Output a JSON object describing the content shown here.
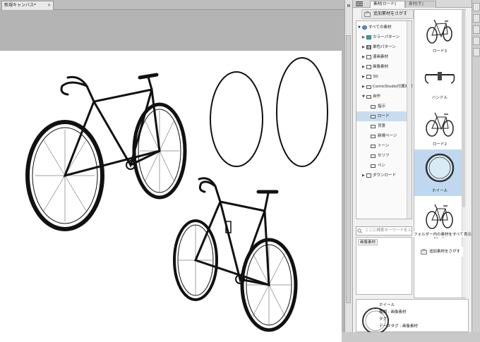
{
  "document": {
    "tab_title": "新規キャンバス*",
    "close_glyph": "×"
  },
  "material_panel": {
    "tabs": [
      "素材[ロード]",
      "素材[手]"
    ],
    "add_material_button": "追加素材をさがす",
    "tree": [
      {
        "label": "すべての素材",
        "icon": "globe-icon",
        "expanded": true,
        "selected": false
      },
      {
        "label": "カラーパターン",
        "icon": "color-pattern-icon",
        "expanded": false,
        "selected": false
      },
      {
        "label": "単色パターン",
        "icon": "mono-pattern-icon",
        "expanded": false,
        "selected": false
      },
      {
        "label": "漫画素材",
        "icon": "manga-icon",
        "expanded": false,
        "selected": false
      },
      {
        "label": "画像素材",
        "icon": "image-icon",
        "expanded": false,
        "selected": false
      },
      {
        "label": "3D",
        "icon": "3d-icon",
        "expanded": false,
        "selected": false
      },
      {
        "label": "ComicStudio付属素材",
        "icon": "folder-icon",
        "expanded": false,
        "selected": false
      },
      {
        "label": "自作",
        "icon": "folder-icon",
        "expanded": true,
        "selected": false
      },
      {
        "label": "指示",
        "icon": "folder-icon",
        "expanded": false,
        "selected": false
      },
      {
        "label": "ロード",
        "icon": "folder-icon",
        "expanded": false,
        "selected": true
      },
      {
        "label": "背景",
        "icon": "folder-icon",
        "expanded": false,
        "selected": false
      },
      {
        "label": "新規ページ",
        "icon": "folder-icon",
        "expanded": false,
        "selected": false
      },
      {
        "label": "トーン",
        "icon": "folder-icon",
        "expanded": false,
        "selected": false
      },
      {
        "label": "セリフ",
        "icon": "folder-icon",
        "expanded": false,
        "selected": false
      },
      {
        "label": "ペン",
        "icon": "folder-icon",
        "expanded": false,
        "selected": false
      },
      {
        "label": "ダウンロード",
        "icon": "download-icon",
        "expanded": false,
        "selected": false
      }
    ],
    "search_placeholder": "ここに検索キーワードを入...",
    "tag": "画像素材",
    "materials": [
      {
        "caption": "ロード3",
        "selected": false
      },
      {
        "caption": "ハンドル",
        "selected": false
      },
      {
        "caption": "ロード2",
        "selected": false
      },
      {
        "caption": "ホイール",
        "selected": true
      },
      {
        "caption": "ロード",
        "selected": false
      }
    ],
    "show_all_label": "フォルダー内の素材をすべて表示",
    "add_material_button_bottom": "追加素材をさがす",
    "detail": {
      "name": "ホイール",
      "kind": "種類 : 画像素材",
      "tag": "タグ :",
      "data_tag": "データタグ : 画像素材"
    }
  },
  "colors": {
    "selection": "#c7dcef",
    "panel_bg": "#f1f1f1",
    "paper": "#ffffff",
    "workspace": "#b4b4b4"
  }
}
